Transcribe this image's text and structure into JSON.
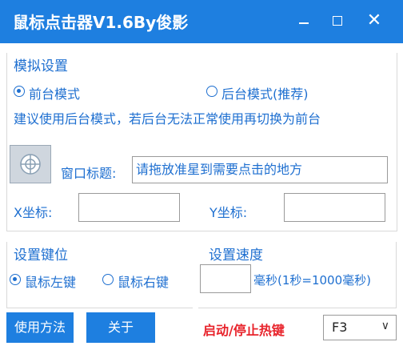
{
  "window": {
    "title": "鼠标点击器V1.6By俊影",
    "minimize_glyph": "",
    "close_glyph": "✕"
  },
  "simulation": {
    "group_title": "模拟设置",
    "mode_front": "前台模式",
    "mode_back": "后台模式(推荐)",
    "selected_mode": "前台模式",
    "hint": "建议使用后台模式，若后台无法正常使用再切换为前台"
  },
  "target": {
    "title_label": "窗口标题:",
    "title_value": "请拖放准星到需要点击的地方",
    "x_label": "X坐标:",
    "x_value": "",
    "y_label": "Y坐标:",
    "y_value": ""
  },
  "keys": {
    "group_title": "设置键位",
    "left": "鼠标左键",
    "right": "鼠标右键",
    "selected": "鼠标左键"
  },
  "speed": {
    "group_title": "设置速度",
    "value": "",
    "unit_label": "毫秒(1秒=1000毫秒)"
  },
  "footer": {
    "usage_button": "使用方法",
    "about_button": "关于",
    "hotkey_label": "启动/停止热键",
    "hotkey_value": "F3",
    "hotkey_chevron": "∨"
  },
  "colors": {
    "accent": "#1e7fe0",
    "text_blue": "#1e6fd0",
    "hotkey_red": "#e8232b"
  },
  "icons": {
    "target": "crosshair-icon",
    "minimize": "minimize-icon",
    "maximize": "maximize-icon",
    "close": "close-icon"
  }
}
